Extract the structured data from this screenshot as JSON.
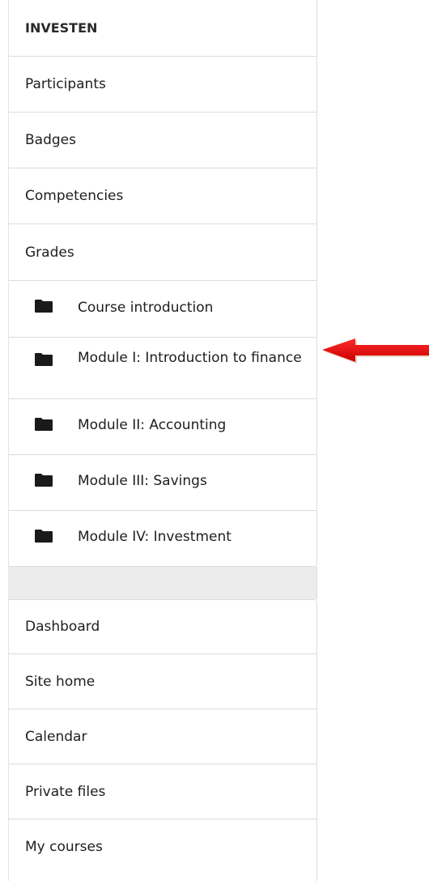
{
  "course_nav": {
    "title": "INVESTEN",
    "items": [
      {
        "label": "Participants"
      },
      {
        "label": "Badges"
      },
      {
        "label": "Competencies"
      },
      {
        "label": "Grades"
      }
    ],
    "sections": [
      {
        "label": "Course introduction",
        "icon": "folder-icon"
      },
      {
        "label": "Module I: Introduction to finance",
        "icon": "folder-icon"
      },
      {
        "label": "Module II: Accounting",
        "icon": "folder-icon"
      },
      {
        "label": "Module III: Savings",
        "icon": "folder-icon"
      },
      {
        "label": "Module IV: Investment",
        "icon": "folder-icon"
      }
    ]
  },
  "site_nav": {
    "items": [
      {
        "label": "Dashboard"
      },
      {
        "label": "Site home"
      },
      {
        "label": "Calendar"
      },
      {
        "label": "Private files"
      },
      {
        "label": "My courses"
      }
    ]
  },
  "annotation": {
    "arrow_color": "#e60000",
    "points_to": "Module I: Introduction to finance"
  }
}
